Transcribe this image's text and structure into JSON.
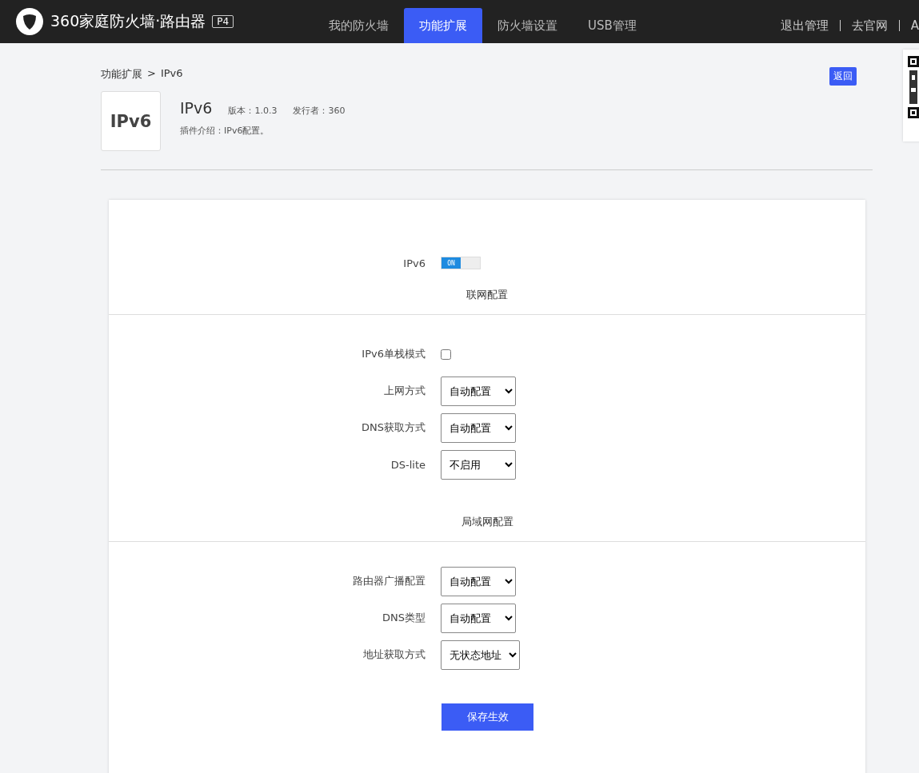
{
  "header": {
    "brand": "360家庭防火墙·路由器",
    "model": "P4",
    "tabs": [
      {
        "label": "我的防火墙",
        "selected": false
      },
      {
        "label": "功能扩展",
        "selected": true
      },
      {
        "label": "防火墙设置",
        "selected": false
      },
      {
        "label": "USB管理",
        "selected": false
      }
    ],
    "links": [
      "退出管理",
      "去官网",
      "A"
    ]
  },
  "breadcrumb": {
    "parent": "功能扩展",
    "separator": ">",
    "current": "IPv6"
  },
  "plugin": {
    "logo": "IPv6",
    "name": "IPv6",
    "version": "版本：1.0.3",
    "publisher": "发行者：360",
    "description": "插件介绍：IPv6配置。"
  },
  "back_button": "返回",
  "form": {
    "toggle": {
      "label": "IPv6",
      "on": true,
      "on_text": "ON"
    },
    "sections": [
      {
        "title": "联网配置",
        "rows": [
          {
            "kind": "checkbox",
            "label": "IPv6单栈模式",
            "checked": false
          },
          {
            "kind": "select",
            "label": "上网方式",
            "value": "自动配置"
          },
          {
            "kind": "select",
            "label": "DNS获取方式",
            "value": "自动配置"
          },
          {
            "kind": "select",
            "label": "DS-lite",
            "value": "不启用"
          }
        ]
      },
      {
        "title": "局域网配置",
        "rows": [
          {
            "kind": "select",
            "label": "路由器广播配置",
            "value": "自动配置"
          },
          {
            "kind": "select",
            "label": "DNS类型",
            "value": "自动配置"
          },
          {
            "kind": "select",
            "label": "地址获取方式",
            "value": "无状态地址"
          }
        ]
      }
    ],
    "save_button": "保存生效"
  }
}
